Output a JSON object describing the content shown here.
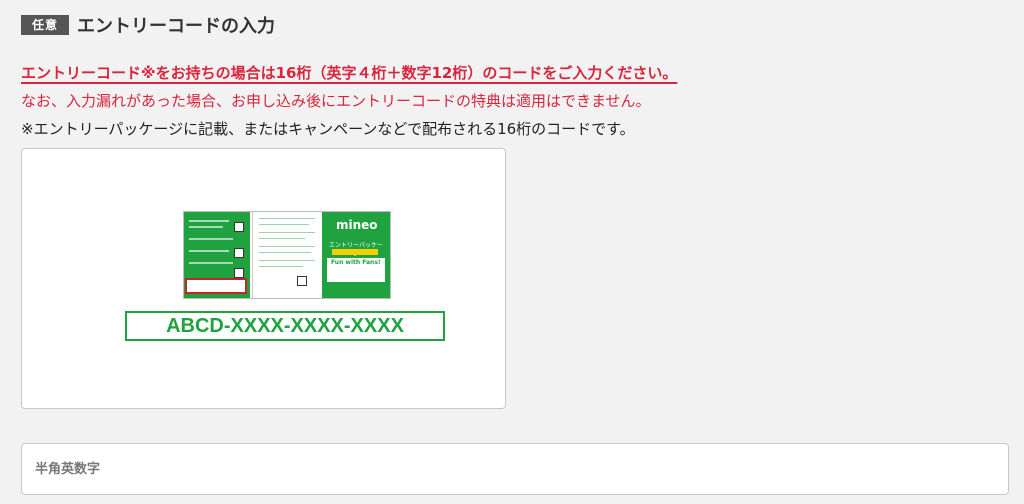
{
  "section": {
    "badge": "任意",
    "title": "エントリーコードの入力"
  },
  "notes": {
    "line1": "エントリーコード※をお持ちの場合は16桁（英字４桁＋数字12桁）のコードをご入力ください。",
    "line2": "なお、入力漏れがあった場合、お申し込み後にエントリーコードの特典は適用はできません。",
    "line3": "※エントリーパッケージに記載、またはキャンペーンなどで配布される16桁のコードです。"
  },
  "example": {
    "brand": "mineo",
    "package_label": "エントリーパッケージ",
    "fans_text": "Fun with Fans!",
    "code": "ABCD-XXXX-XXXX-XXXX"
  },
  "input": {
    "placeholder": "半角英数字",
    "value": ""
  },
  "colors": {
    "accent_red": "#d7263d",
    "brand_green": "#1fa23f",
    "badge_bg": "#555555"
  }
}
